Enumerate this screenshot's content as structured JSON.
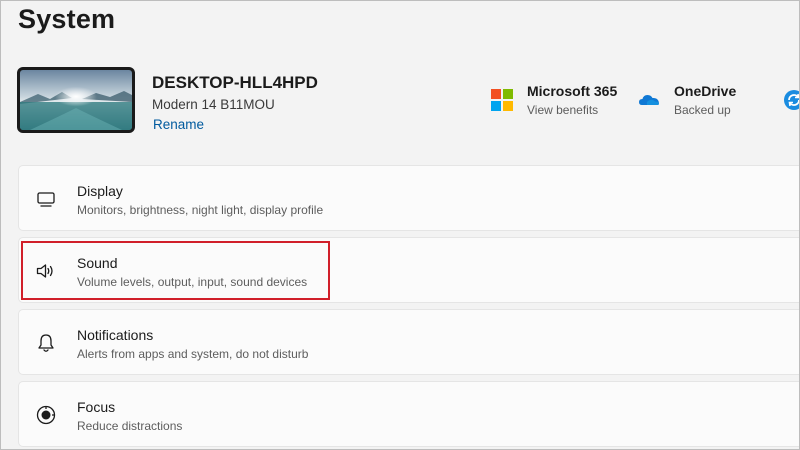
{
  "page": {
    "title": "System"
  },
  "device": {
    "name": "DESKTOP-HLL4HPD",
    "model": "Modern 14 B11MOU",
    "rename_label": "Rename"
  },
  "quick_tiles": [
    {
      "title": "Microsoft 365",
      "subtitle": "View benefits",
      "icon": "microsoft-logo-icon"
    },
    {
      "title": "OneDrive",
      "subtitle": "Backed up",
      "icon": "onedrive-cloud-icon"
    },
    {
      "title": "",
      "subtitle": "",
      "icon": "sync-icon"
    }
  ],
  "settings_items": [
    {
      "title": "Display",
      "subtitle": "Monitors, brightness, night light, display profile",
      "icon": "display-icon"
    },
    {
      "title": "Sound",
      "subtitle": "Volume levels, output, input, sound devices",
      "icon": "speaker-icon"
    },
    {
      "title": "Notifications",
      "subtitle": "Alerts from apps and system, do not disturb",
      "icon": "bell-icon"
    },
    {
      "title": "Focus",
      "subtitle": "Reduce distractions",
      "icon": "focus-icon"
    }
  ],
  "colors": {
    "background": "#f3f3f3",
    "card": "#fbfbfb",
    "link": "#005a9e",
    "highlight": "#d11f2a",
    "ms_red": "#f25022",
    "ms_green": "#7fba00",
    "ms_blue": "#00a4ef",
    "ms_yellow": "#ffb900",
    "onedrive_blue": "#0f78d4"
  }
}
